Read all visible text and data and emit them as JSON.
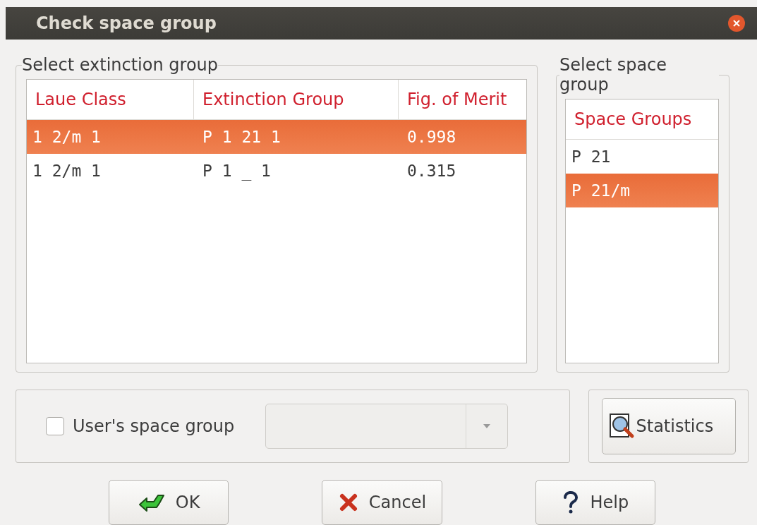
{
  "window": {
    "title": "Check space group"
  },
  "extinction_group": {
    "title": "Select extinction group",
    "columns": [
      "Laue Class",
      "Extinction Group",
      "Fig. of Merit"
    ],
    "rows": [
      {
        "cells": [
          "1 2/m 1",
          "P 1 21 1",
          "0.998"
        ],
        "selected": true
      },
      {
        "cells": [
          "1 2/m 1",
          "P 1 _ 1",
          "0.315"
        ],
        "selected": false
      }
    ]
  },
  "space_group": {
    "title": "Select space group",
    "column": "Space Groups",
    "rows": [
      {
        "label": "P 21",
        "selected": false
      },
      {
        "label": "P 21/m",
        "selected": true
      }
    ]
  },
  "user_space_group": {
    "label": "User's space group",
    "checked": false
  },
  "statistics_button": "Statistics",
  "buttons": [
    {
      "kind": "ok",
      "label": "OK"
    },
    {
      "kind": "cancel",
      "label": "Cancel"
    },
    {
      "kind": "help",
      "label": "Help"
    }
  ]
}
